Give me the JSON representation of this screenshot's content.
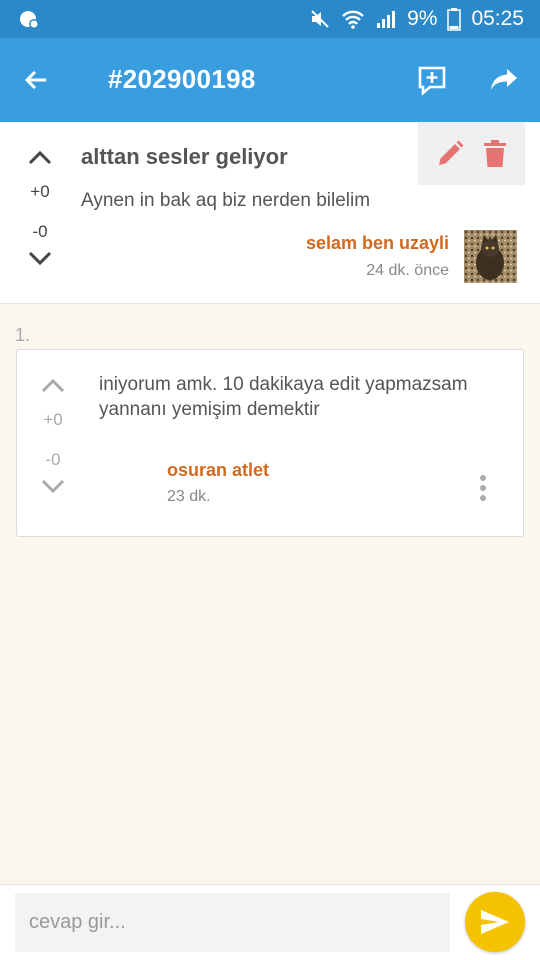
{
  "status_bar": {
    "battery_percent": "9%",
    "time": "05:25",
    "icons": [
      "notification-icon",
      "mute-icon",
      "wifi-icon",
      "signal-icon",
      "battery-icon"
    ]
  },
  "app_bar": {
    "title": "#202900198",
    "icons": [
      "back-arrow-icon",
      "add-comment-icon",
      "share-icon"
    ]
  },
  "post": {
    "title": "alttan sesler geliyor",
    "body": "Aynen in bak aq biz nerden bilelim",
    "upvotes": "+0",
    "downvotes": "-0",
    "author": "selam ben uzayli",
    "time": "24 dk. önce",
    "actions": [
      "edit-icon",
      "delete-icon"
    ]
  },
  "comments": [
    {
      "index": "1.",
      "text": "iniyorum amk. 10 dakikaya edit yapmazsam yannanı yemişim demektir",
      "upvotes": "+0",
      "downvotes": "-0",
      "author": "osuran atlet",
      "time": "23 dk."
    }
  ],
  "reply": {
    "placeholder": "cevap gir...",
    "value": ""
  },
  "colors": {
    "status_bar": "#2b88c9",
    "app_bar": "#3a9de0",
    "author": "#d2691e",
    "send_button": "#f5c200",
    "delete": "#e57373",
    "background": "#faf7ef"
  }
}
